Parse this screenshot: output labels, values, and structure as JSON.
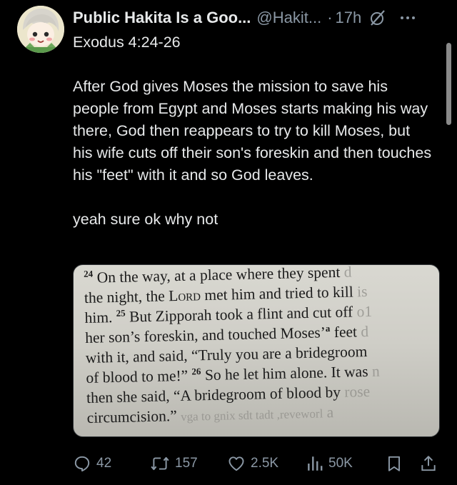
{
  "author": {
    "display_name": "Public Hakita Is a Goo...",
    "handle": "@Hakit...",
    "separator": "·",
    "time": "17h"
  },
  "icons": {
    "grok": "grok-icon",
    "more": "more-icon",
    "reply": "reply-icon",
    "retweet": "retweet-icon",
    "like": "heart-icon",
    "views": "views-icon",
    "bookmark": "bookmark-icon",
    "share": "share-icon"
  },
  "tweet": {
    "paragraphs": [
      "Exodus 4:24-26",
      "After God gives Moses the mission to save his people from Egypt and Moses starts making his way there, God then reappears to try to kill Moses, but his wife cuts off their son's foreskin and then touches his \"feet\" with it and so God leaves.",
      "yeah sure ok why not"
    ]
  },
  "media": {
    "bible_text": {
      "v24_num": "24",
      "v24_a": "On the way, at a place where they spent",
      "v24_b": "the night, the",
      "lord": "Lord",
      "v24_c": "met him and tried to kill",
      "v24_d": "him.",
      "v25_num": "25",
      "v25_a": "But Zipporah took a flint and cut off",
      "v25_b": "her son’s foreskin, and touched Moses’",
      "footnote": "a",
      "v25_c": "feet",
      "v25_d": "with it, and said, “Truly you are a bridegroom",
      "v25_e": "of blood to me!”",
      "v26_num": "26",
      "v26_a": "So he let him alone. It was",
      "v26_b": "then she said, “A bridegroom of blood by",
      "v26_c": "circumcision.”",
      "bleed_1": "d",
      "bleed_2": "is",
      "bleed_3": "o1",
      "bleed_4": "d",
      "bleed_5": "a",
      "bleed_6": "n",
      "bleed_7": "rose",
      "bleed_8": "vga to gnix sdt tadt ,reveworl"
    }
  },
  "actions": {
    "replies": "42",
    "reposts": "157",
    "likes": "2.5K",
    "views": "50K"
  },
  "colors": {
    "background": "#000000",
    "primary_text": "#e7e9ea",
    "secondary_text": "#8b98a5"
  }
}
